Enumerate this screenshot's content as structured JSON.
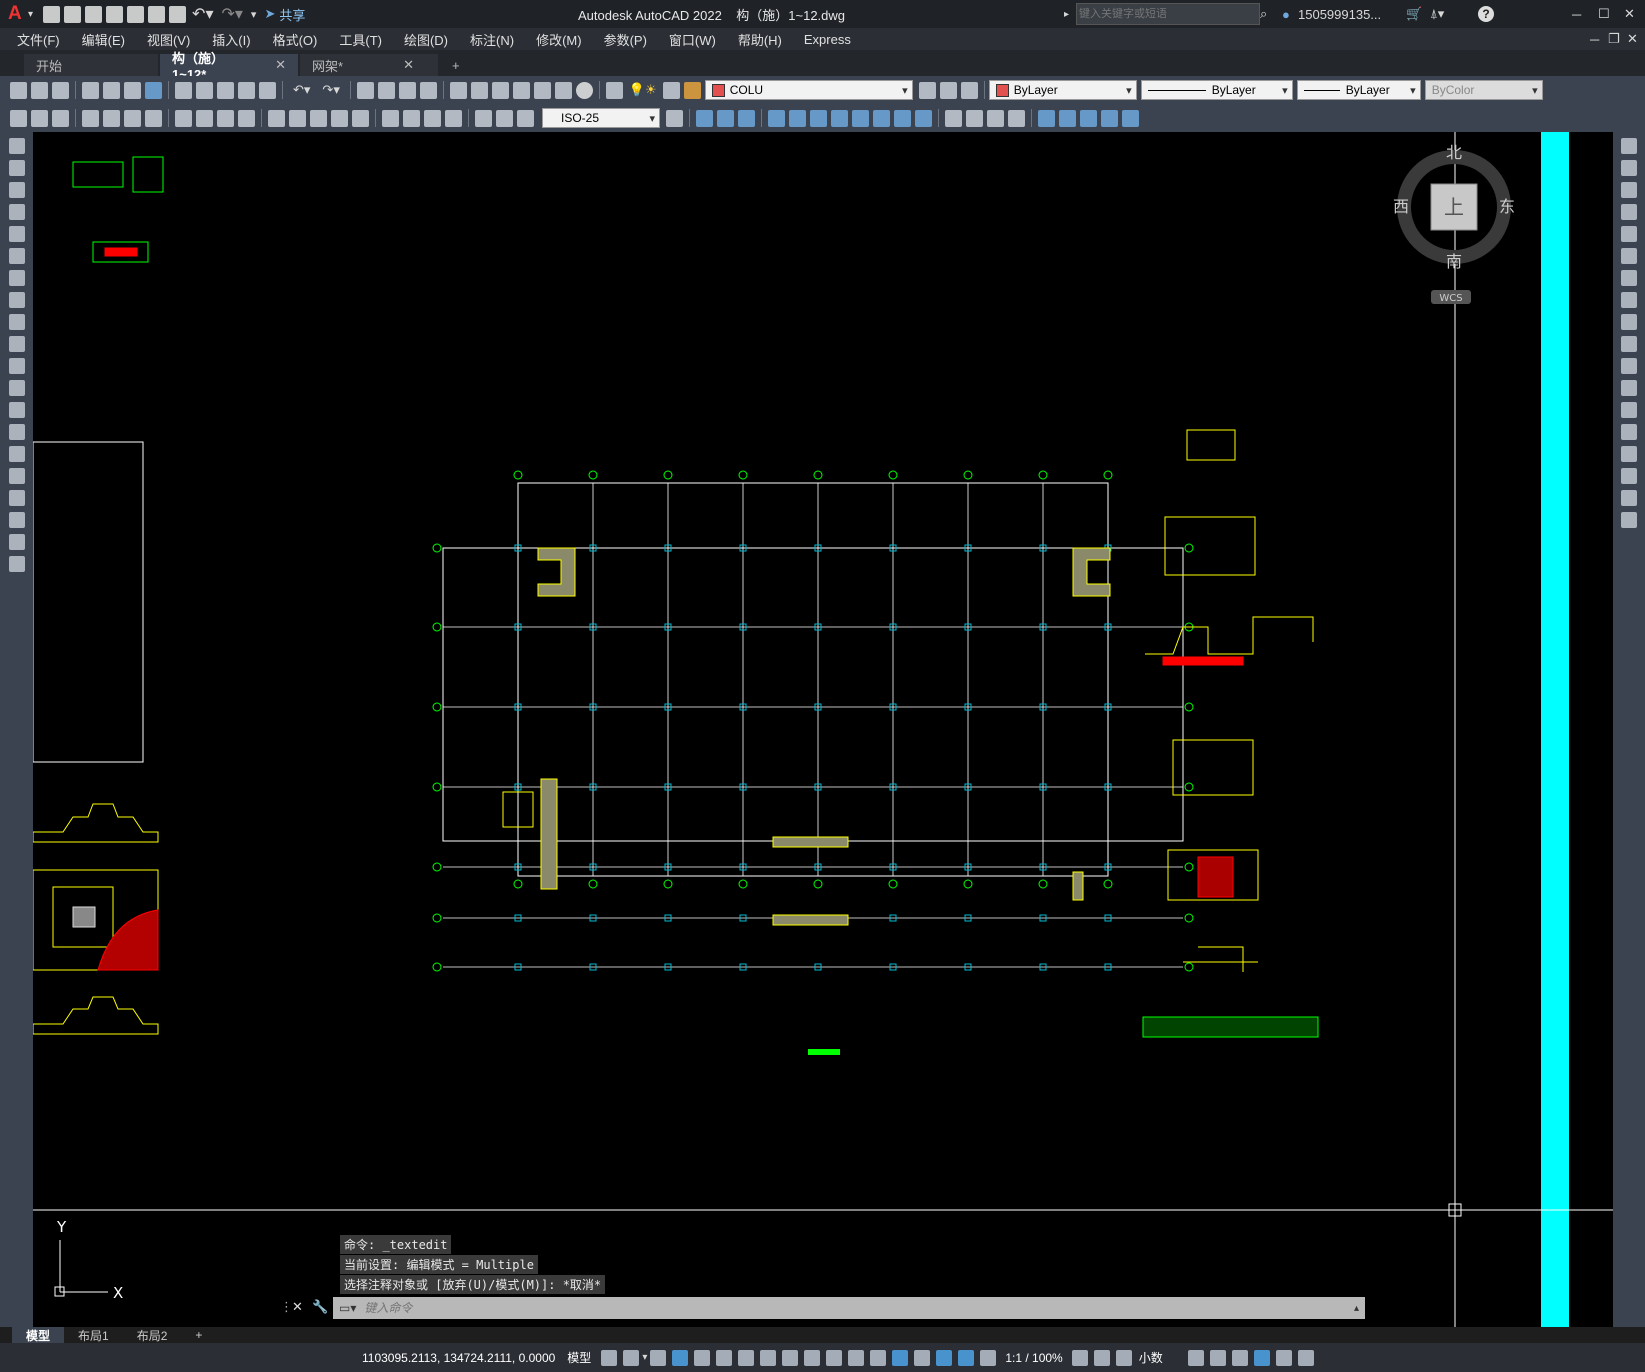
{
  "titlebar": {
    "app_logo": "A",
    "share": "共享",
    "title": "Autodesk AutoCAD 2022    构（施）1~12.dwg",
    "search_placeholder": "键入关键字或短语",
    "user": "1505999135...",
    "help": "?"
  },
  "menu": [
    "文件(F)",
    "编辑(E)",
    "视图(V)",
    "插入(I)",
    "格式(O)",
    "工具(T)",
    "绘图(D)",
    "标注(N)",
    "修改(M)",
    "参数(P)",
    "窗口(W)",
    "帮助(H)",
    "Express"
  ],
  "tabs": [
    {
      "label": "开始"
    },
    {
      "label": "构（施）1~12*"
    },
    {
      "label": "网架*"
    }
  ],
  "toolbar": {
    "layer": "COLU",
    "color": "ByLayer",
    "linetype": "ByLayer",
    "lineweight": "ByLayer",
    "plotstyle": "ByColor",
    "dimstyle": "ISO-25"
  },
  "viewcube": {
    "north": "北",
    "south": "南",
    "east": "东",
    "west": "西",
    "top": "上",
    "wcs": "WCS"
  },
  "ucs": {
    "x": "X",
    "y": "Y"
  },
  "command_history": [
    "命令: _textedit",
    "当前设置: 编辑模式 = Multiple",
    "选择注释对象或 [放弃(U)/模式(M)]: *取消*"
  ],
  "command_placeholder": "键入命令",
  "layout_tabs": [
    "模型",
    "布局1",
    "布局2",
    "+"
  ],
  "status": {
    "coords": "1103095.2113, 134724.2111, 0.0000",
    "model": "模型",
    "scale": "1:1 / 100%",
    "units": "小数"
  },
  "colors": {
    "drawing_bg": "#000000",
    "grid_line": "#ffffff",
    "axis_bubble": "#00ff00",
    "column": "#00bcd4",
    "wall": "#ffff00",
    "fill": "#ff0000",
    "cyan_band": "#00ffff"
  }
}
